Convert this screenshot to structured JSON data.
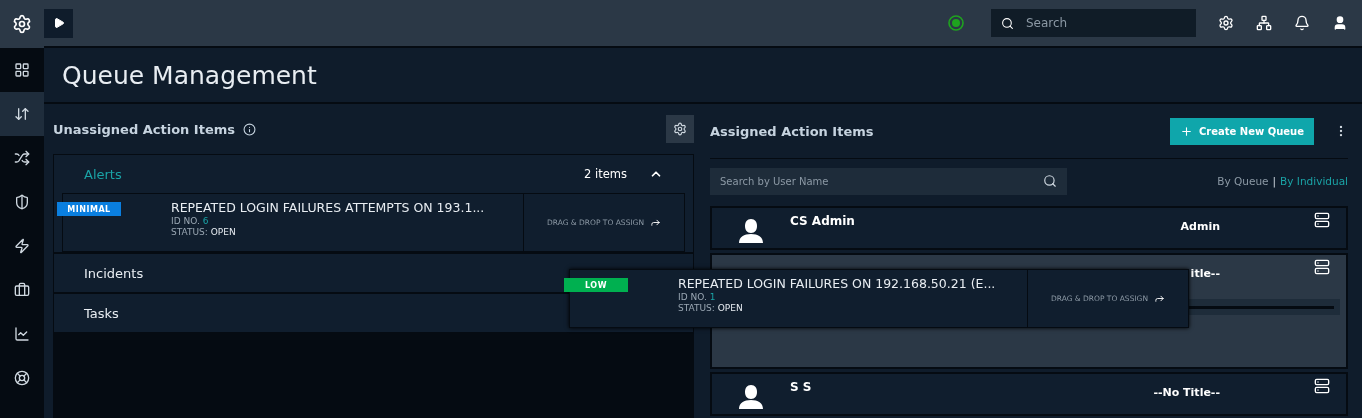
{
  "topbar": {
    "search": {
      "placeholder": "Search"
    }
  },
  "sidebar": {
    "items": [
      {
        "selected": false
      },
      {
        "selected": true
      },
      {
        "selected": false
      },
      {
        "selected": false
      },
      {
        "selected": false
      },
      {
        "selected": false
      },
      {
        "selected": false
      },
      {
        "selected": false
      }
    ]
  },
  "page_title": "Queue Management",
  "unassigned": {
    "title": "Unassigned Action Items",
    "groups": [
      {
        "label": "Alerts",
        "count": "2 items",
        "expanded": true,
        "selected": true,
        "items": [
          {
            "severity": "MINIMAL",
            "color": "#0a7fe0",
            "title": "REPEATED LOGIN FAILURES ATTEMPTS ON 193.1...",
            "id_label": "ID NO.",
            "id": "6",
            "status_label": "STATUS:",
            "status": "OPEN",
            "action": "DRAG & DROP TO ASSIGN"
          }
        ]
      },
      {
        "label": "Incidents",
        "expanded": false,
        "selected": false
      },
      {
        "label": "Tasks",
        "expanded": false,
        "selected": false
      }
    ]
  },
  "dragged_item": {
    "severity": "LOW",
    "color": "#00b050",
    "title": "REPEATED LOGIN FAILURES ON 192.168.50.21 (E...",
    "id_label": "ID NO.",
    "id": "1",
    "status_label": "STATUS:",
    "status": "OPEN",
    "action": "DRAG & DROP TO ASSIGN"
  },
  "assigned": {
    "title": "Assigned Action Items",
    "create_button": "Create New Queue",
    "search": {
      "placeholder": "Search by User Name"
    },
    "views": [
      {
        "label": "By Queue",
        "selected": false
      },
      {
        "label": "By Individual",
        "selected": true
      }
    ],
    "separator": "|",
    "users": [
      {
        "name": "CS Admin",
        "title": "Admin",
        "expanded": false
      },
      {
        "title": "itle--",
        "expanded": true
      },
      {
        "name": "S S",
        "title": "--No Title--",
        "expanded": false
      }
    ]
  }
}
